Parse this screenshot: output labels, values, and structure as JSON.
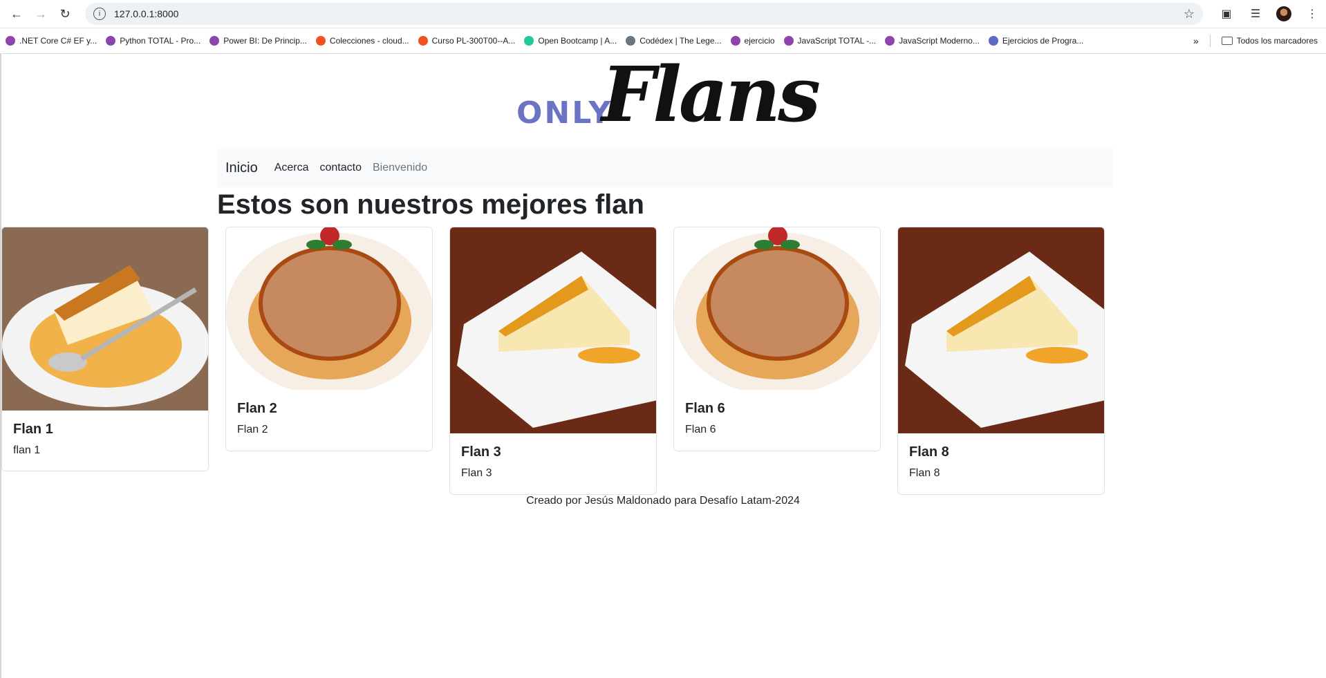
{
  "browser": {
    "url": "127.0.0.1:8000",
    "bookmarks": [
      {
        "label": ".NET Core C# EF y...",
        "color": "#8e44ad"
      },
      {
        "label": "Python TOTAL - Pro...",
        "color": "#8e44ad"
      },
      {
        "label": "Power BI: De Princip...",
        "color": "#8e44ad"
      },
      {
        "label": "Colecciones - cloud...",
        "color": "#f25022"
      },
      {
        "label": "Curso PL-300T00--A...",
        "color": "#f25022"
      },
      {
        "label": "Open Bootcamp | A...",
        "color": "#20c997"
      },
      {
        "label": "Codédex | The Lege...",
        "color": "#6c757d"
      },
      {
        "label": "ejercicio",
        "color": "#8e44ad"
      },
      {
        "label": "JavaScript TOTAL -...",
        "color": "#8e44ad"
      },
      {
        "label": "JavaScript Moderno...",
        "color": "#8e44ad"
      },
      {
        "label": "Ejercicios de Progra...",
        "color": "#5c6bc0"
      }
    ],
    "all_bookmarks_label": "Todos los marcadores"
  },
  "logo": {
    "only": "ONLY",
    "flans": "Flans"
  },
  "navbar": {
    "brand": "Inicio",
    "links": [
      "Acerca",
      "contacto",
      "Bienvenido"
    ]
  },
  "heading": "Estos son nuestros mejores flan",
  "cards": [
    {
      "title": "Flan 1",
      "text": "flan 1",
      "image": "flan-slice-with-spoon"
    },
    {
      "title": "Flan 2",
      "text": "Flan 2",
      "image": "whole-flan-with-mint"
    },
    {
      "title": "Flan 3",
      "text": "Flan 3",
      "image": "flan-slice-square-plate"
    },
    {
      "title": "Flan 6",
      "text": "Flan 6",
      "image": "whole-flan-with-mint"
    },
    {
      "title": "Flan 8",
      "text": "Flan 8",
      "image": "flan-slice-square-plate"
    }
  ],
  "footer": "Creado por Jesús Maldonado para Desafío Latam-2024"
}
